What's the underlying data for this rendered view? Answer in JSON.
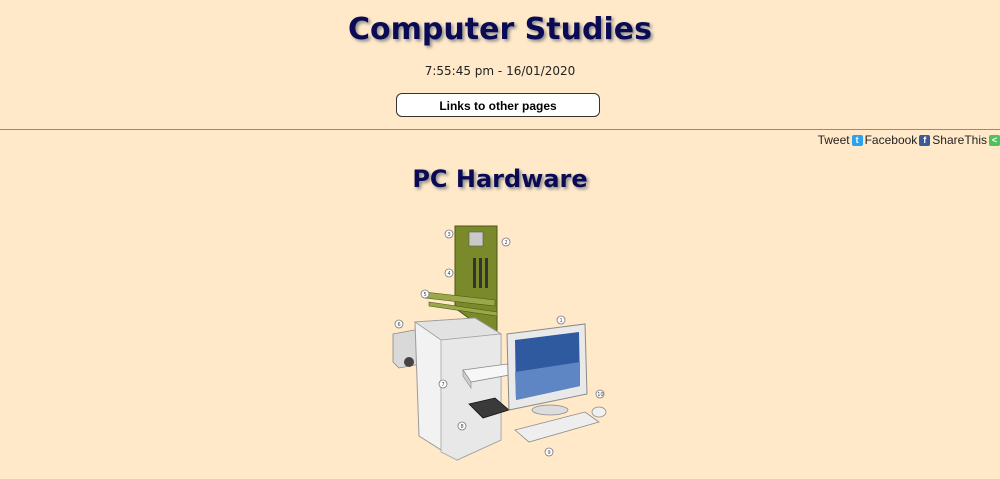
{
  "header": {
    "title": "Computer Studies",
    "datetime": "7:55:45 pm - 16/01/2020",
    "links_button_label": "Links to other pages"
  },
  "share_bar": {
    "items": [
      {
        "label": "Tweet",
        "icon": "twitter-icon",
        "color": "#2aa3ef"
      },
      {
        "label": "Facebook",
        "icon": "facebook-icon",
        "color": "#3b5998"
      },
      {
        "label": "ShareThis",
        "icon": "sharethis-icon",
        "color": "#4fc25a"
      }
    ]
  },
  "main": {
    "section_title": "PC Hardware",
    "illustration": {
      "icon": "pc-hardware-exploded-diagram",
      "callouts": [
        "1",
        "2",
        "3",
        "4",
        "5",
        "6",
        "7",
        "8",
        "9",
        "10"
      ]
    }
  },
  "colors": {
    "background": "#ffe9c9",
    "heading": "#0b0b55",
    "motherboard": "#7a8a2a",
    "monitor_screen": "#2f5aa0"
  }
}
